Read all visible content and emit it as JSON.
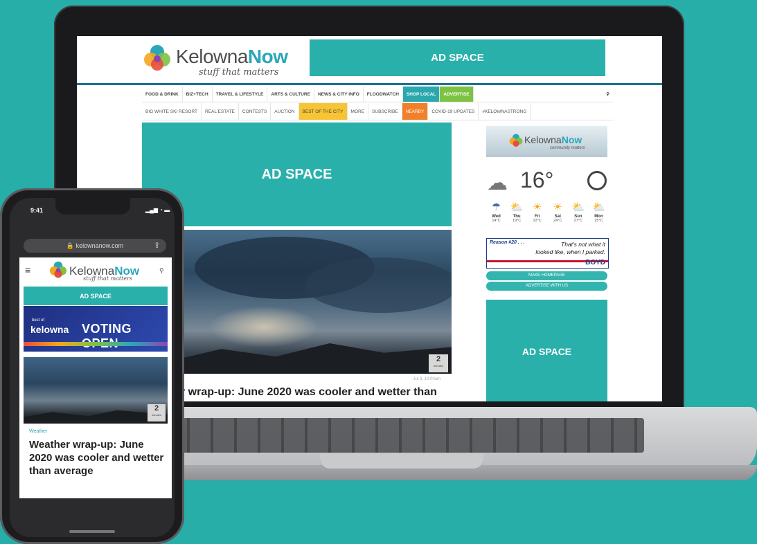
{
  "brand": {
    "name_part1": "Kelowna",
    "name_part2": "Now",
    "tagline": "stuff that matters",
    "side_tagline": "community matters",
    "colors": {
      "teal": "#2ab0ab",
      "blue": "#1f6f95",
      "green": "#7dc243",
      "yellow": "#f7c434",
      "orange": "#f2802a"
    }
  },
  "laptop": {
    "top_ad": "AD SPACE",
    "nav_primary": [
      {
        "label": "FOOD & DRINK",
        "style": ""
      },
      {
        "label": "BIZ+TECH",
        "style": ""
      },
      {
        "label": "TRAVEL & LIFESTYLE",
        "style": ""
      },
      {
        "label": "ARTS & CULTURE",
        "style": ""
      },
      {
        "label": "NEWS & CITY INFO",
        "style": ""
      },
      {
        "label": "FLOODWATCH",
        "style": ""
      },
      {
        "label": "SHOP LOCAL",
        "style": "teal"
      },
      {
        "label": "ADVERTISE",
        "style": "green"
      }
    ],
    "nav_secondary": [
      {
        "label": "BIG WHITE SKI RESORT",
        "style": ""
      },
      {
        "label": "REAL ESTATE",
        "style": ""
      },
      {
        "label": "CONTESTS",
        "style": ""
      },
      {
        "label": "AUCTION",
        "style": ""
      },
      {
        "label": "BEST OF THE CITY",
        "style": "yellow"
      },
      {
        "label": "MORE",
        "style": ""
      },
      {
        "label": "SUBSCRIBE",
        "style": ""
      },
      {
        "label": "NEARBY",
        "style": "orange"
      },
      {
        "label": "COVID-19 UPDATES",
        "style": ""
      },
      {
        "label": "#KELOWNASTRONG",
        "style": ""
      }
    ],
    "main_ad": "AD SPACE",
    "article": {
      "minutes": "2",
      "minutes_unit": "minutes",
      "date": "- Jul 3, 10:00am",
      "headline": "r wrap-up: June 2020 was cooler and wetter than"
    },
    "sidebar": {
      "weather": {
        "temperature": "16°",
        "forecast": [
          {
            "day": "Wed",
            "temp": "14°C",
            "icon": "storm-icon"
          },
          {
            "day": "Thu",
            "temp": "19°C",
            "icon": "sun-cloud-icon"
          },
          {
            "day": "Fri",
            "temp": "22°C",
            "icon": "sun-icon"
          },
          {
            "day": "Sat",
            "temp": "24°C",
            "icon": "sun-icon"
          },
          {
            "day": "Sun",
            "temp": "27°C",
            "icon": "sun-cloud-icon"
          },
          {
            "day": "Mon",
            "temp": "25°C",
            "icon": "sun-cloud-icon"
          }
        ]
      },
      "boyd_ad": {
        "reason": "Reason #20 . . .",
        "quote_line1": "That's not what it",
        "quote_line2": "looked like, when I parked.",
        "brand": "BOYD"
      },
      "button_home": "MAKE HOMEPAGE",
      "button_advertise": "ADVERTISE WITH US",
      "side_ad": "AD SPACE"
    }
  },
  "phone": {
    "time": "9:41",
    "status": "▂▄▆ ◔ ▬",
    "url": "🔒 kelownanow.com",
    "ad": "AD SPACE",
    "banner": {
      "small": "best of",
      "city": "kelowna",
      "text": "VOTING OPEN"
    },
    "article": {
      "minutes": "2",
      "minutes_unit": "minutes",
      "category": "Weather",
      "headline": "Weather wrap-up: June 2020 was cooler and wetter than average"
    }
  }
}
